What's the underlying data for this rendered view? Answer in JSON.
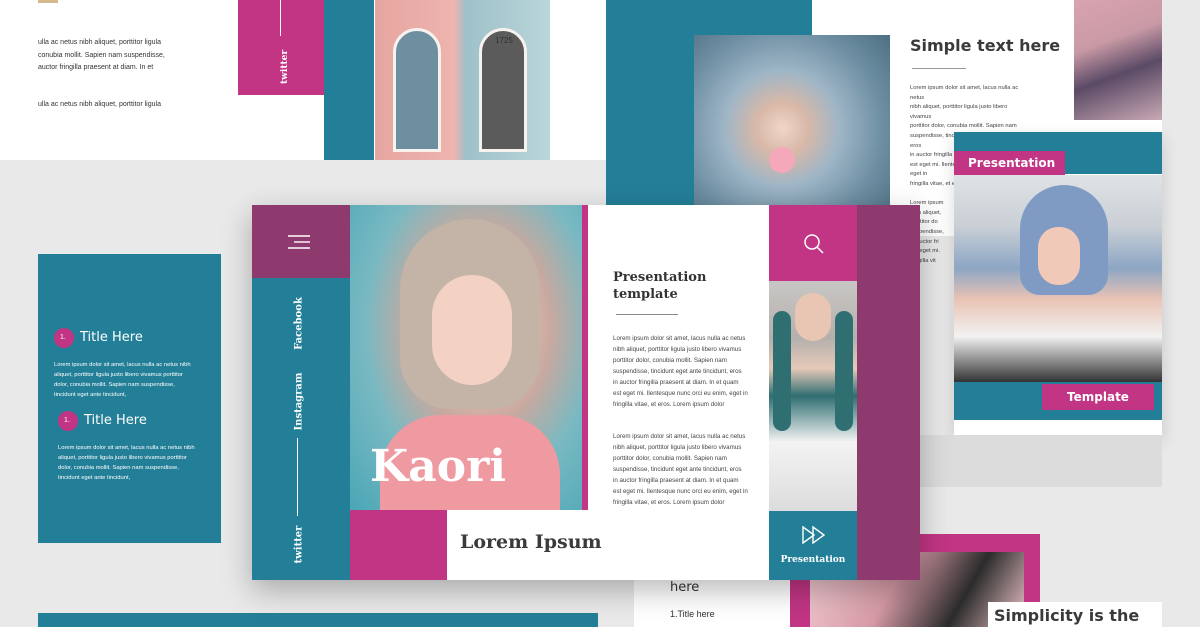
{
  "colors": {
    "teal": "#237f97",
    "magenta": "#c13584",
    "plum": "#8f3a6e",
    "white": "#ffffff",
    "bg": "#e9e9e9"
  },
  "top_left_slide": {
    "line1": "ulla ac netus nibh aliquet, porttitor ligula",
    "line2": "conubia mollit. Sapien nam suspendisse,",
    "line3": "auctor fringilla praesent at diam. In et",
    "line4": "ulla ac netus nibh aliquet, porttitor ligula"
  },
  "top_mid_slide": {
    "twitter": "twitter",
    "door_number": "1725"
  },
  "top_right_slide": {
    "title": "Simple text here",
    "body": [
      "Lorem ipsum dolor sit amet, lacus nulla ac netus",
      "nibh aliquet, porttitor ligula justo libero vivamus",
      "porttitor dolor, conubia mollit. Sapien nam",
      "suspendisse, tincidunt eget ante tincidunt, eros",
      "in auctor fringilla praesent at diam. In et quam",
      "est eget mi. Ilentesque nunc orci eu enim, eget in",
      "fringilla vitae, et eros.",
      "",
      "Lorem ipsum",
      "nibh aliquet,",
      "porttitor do",
      "suspendisse,",
      "in auctor fri",
      "est eget mi.",
      "fringilla vit"
    ]
  },
  "right_slide": {
    "presentation_label": "Presentation",
    "template_label": "Template"
  },
  "left_slide": {
    "items": [
      {
        "num": "1.",
        "title": "Title Here",
        "text": [
          "Lorem ipsum dolor sit amet, lacus nulla ac netus nibh",
          "aliquet, porttitor ligula justo libero vivamus porttitor",
          "dolor, conubia mollit. Sapien nam suspendisse,",
          "tincidunt eget ante tincidunt,"
        ]
      },
      {
        "num": "1.",
        "title": "Title Here",
        "text": [
          "Lorem ipsum dolor sit amet, lacus nulla ac netus nibh",
          "aliquet, porttitor ligula justo libero vivamus porttitor",
          "dolor, conubia mollit. Sapien nam suspendisse,",
          "tincidunt eget ante tincidunt,"
        ]
      }
    ]
  },
  "bottom_slide": {
    "here": "here",
    "title_item": "1.Title here",
    "simplicity": "Simplicity is the"
  },
  "main_slide": {
    "social": [
      "Facebook",
      "Instagram",
      "twitter"
    ],
    "hero_title": "Kaori",
    "footer_title": "Lorem Ipsum",
    "heading": "Presentation template",
    "paragraph1": [
      "Lorem ipsum dolor sit amet, lacus nulla ac netus",
      "nibh aliquet, porttitor ligula justo libero vivamus",
      "porttitor dolor, conubia mollit. Sapien nam",
      "suspendisse, tincidunt eget ante tincidunt, eros",
      "in auctor fringilla praesent at diam. In et quam",
      "est eget mi. Ilentesque nunc orci eu enim, eget in",
      "fringilla vitae, et eros. Lorem ipsum dolor"
    ],
    "paragraph2": [
      "Lorem ipsum dolor sit amet, lacus nulla ac netus",
      "nibh aliquet, porttitor ligula justo libero vivamus",
      "porttitor dolor, conubia mollit. Sapien nam",
      "suspendisse, tincidunt eget ante tincidunt, eros",
      "in auctor fringilla praesent at diam. In et quam",
      "est eget mi. Ilentesque nunc orci eu enim, eget in",
      "fringilla vitae, et eros. Lorem ipsum dolor"
    ],
    "presentation_label": "Presentation",
    "icons": {
      "menu": "menu-icon",
      "search": "search-icon",
      "play": "fast-forward-icon"
    }
  }
}
